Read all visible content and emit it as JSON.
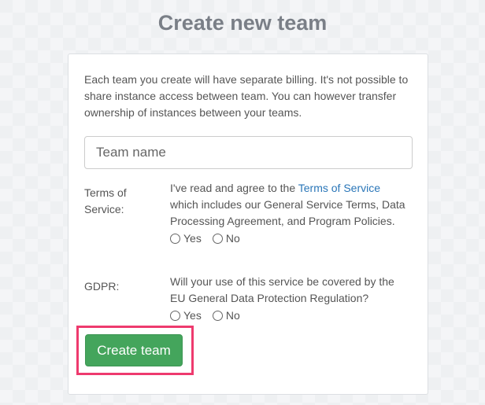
{
  "page": {
    "title": "Create new team"
  },
  "form": {
    "intro": "Each team you create will have separate billing. It's not possible to share instance access between team. You can however transfer ownership of instances between your teams.",
    "team_name_placeholder": "Team name",
    "tos": {
      "label": "Terms of Service:",
      "text_before": "I've read and agree to the ",
      "link": "Terms of Service",
      "text_after": " which includes our General Service Terms, Data Processing Agreement, and Program Policies.",
      "yes": "Yes",
      "no": "No"
    },
    "gdpr": {
      "label": "GDPR:",
      "text": "Will your use of this service be covered by the EU General Data Protection Regulation?",
      "yes": "Yes",
      "no": "No"
    },
    "submit": "Create team"
  },
  "colors": {
    "accent": "#44a55c",
    "link": "#2a76b8",
    "highlight": "#ee3a6e"
  }
}
